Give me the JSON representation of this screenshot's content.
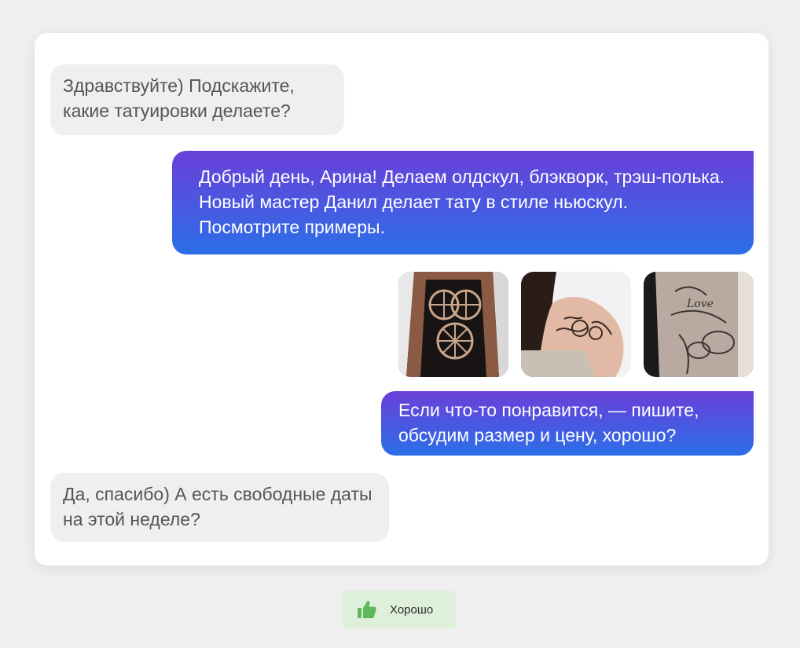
{
  "chat": {
    "messages": [
      {
        "sender": "client",
        "text": "Здравствуйте) Подскажите, какие татуировки делаете?"
      },
      {
        "sender": "studio",
        "text": "Добрый день, Арина! Делаем олдскул, блэкворк, трэш-полька. Новый мастер Данил делает тату в стиле ньюскул. Посмотрите примеры."
      },
      {
        "sender": "studio",
        "text": "Если что-то понравится, — пишите, обсудим размер и цену, хорошо?"
      },
      {
        "sender": "client",
        "text": "Да, спасибо) А есть свободные даты на этой неделе?"
      }
    ],
    "photos": [
      {
        "icon": "blackwork-tattoo-photo"
      },
      {
        "icon": "floral-shoulder-tattoo-photo"
      },
      {
        "icon": "sleeve-tattoo-photo"
      }
    ]
  },
  "reaction": {
    "label": "Хорошо",
    "icon": "thumbs-up-icon",
    "accent": "#5cb85c"
  },
  "colors": {
    "outgoing_top": "#6a3fd8",
    "outgoing_bottom": "#2b6fe8",
    "incoming_bg": "#efefef"
  }
}
